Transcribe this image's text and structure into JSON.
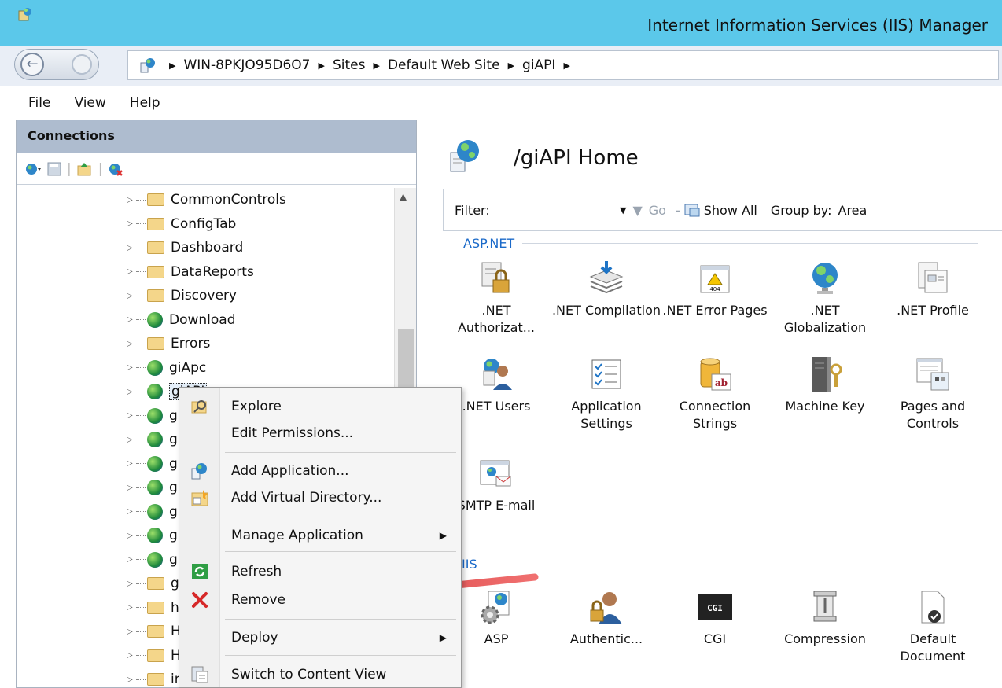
{
  "window": {
    "title": "Internet Information Services (IIS) Manager"
  },
  "breadcrumb": [
    "WIN-8PKJO95D6O7",
    "Sites",
    "Default Web Site",
    "giAPI"
  ],
  "menu": [
    "File",
    "View",
    "Help"
  ],
  "connections": {
    "header": "Connections",
    "tree": [
      {
        "label": "CommonControls",
        "type": "folder"
      },
      {
        "label": "ConfigTab",
        "type": "folder"
      },
      {
        "label": "Dashboard",
        "type": "folder"
      },
      {
        "label": "DataReports",
        "type": "folder"
      },
      {
        "label": "Discovery",
        "type": "folder"
      },
      {
        "label": "Download",
        "type": "app"
      },
      {
        "label": "Errors",
        "type": "folder"
      },
      {
        "label": "giApc",
        "type": "app"
      },
      {
        "label": "giAPI",
        "type": "app"
      },
      {
        "label": "gi",
        "type": "app"
      },
      {
        "label": "gi",
        "type": "app"
      },
      {
        "label": "gi",
        "type": "app"
      },
      {
        "label": "gi",
        "type": "app"
      },
      {
        "label": "gi",
        "type": "app"
      },
      {
        "label": "gi",
        "type": "app"
      },
      {
        "label": "gi",
        "type": "app"
      },
      {
        "label": "gi",
        "type": "folder"
      },
      {
        "label": "he",
        "type": "folder"
      },
      {
        "label": "H",
        "type": "folder"
      },
      {
        "label": "H",
        "type": "folder"
      },
      {
        "label": "im",
        "type": "folder"
      }
    ]
  },
  "main": {
    "title": "/giAPI Home",
    "filter": {
      "label": "Filter:",
      "go": "Go",
      "show_all": "Show All",
      "group_by": "Group by:",
      "group_value": "Area"
    },
    "groups": [
      {
        "name": "ASP.NET",
        "features": [
          {
            "label": ".NET Authorizat...",
            "icon": "lock-doc-icon"
          },
          {
            "label": ".NET Compilation",
            "icon": "layers-icon"
          },
          {
            "label": ".NET Error Pages",
            "icon": "error-page-icon"
          },
          {
            "label": ".NET Globalization",
            "icon": "globe-icon"
          },
          {
            "label": ".NET Profile",
            "icon": "profile-icon"
          },
          {
            "label": ".NET Users",
            "icon": "users-icon"
          },
          {
            "label": "Application Settings",
            "icon": "checklist-icon"
          },
          {
            "label": "Connection Strings",
            "icon": "database-icon"
          },
          {
            "label": "Machine Key",
            "icon": "server-key-icon"
          },
          {
            "label": "Pages and Controls",
            "icon": "pages-icon"
          },
          {
            "label": "SMTP E-mail",
            "icon": "email-icon"
          }
        ]
      },
      {
        "name": "IIS",
        "features": [
          {
            "label": "ASP",
            "icon": "asp-icon"
          },
          {
            "label": "Authentic...",
            "icon": "auth-icon"
          },
          {
            "label": "CGI",
            "icon": "cgi-icon"
          },
          {
            "label": "Compression",
            "icon": "compression-icon"
          },
          {
            "label": "Default Document",
            "icon": "default-doc-icon"
          }
        ]
      }
    ]
  },
  "context_menu": {
    "items": [
      {
        "label": "Explore",
        "icon": "explore-icon"
      },
      {
        "label": "Edit Permissions...",
        "icon": ""
      },
      {
        "label": "Add Application...",
        "icon": "add-app-icon"
      },
      {
        "label": "Add Virtual Directory...",
        "icon": "add-vdir-icon"
      },
      {
        "label": "Manage Application",
        "icon": "",
        "submenu": true
      },
      {
        "label": "Refresh",
        "icon": "refresh-icon"
      },
      {
        "label": "Remove",
        "icon": "remove-icon"
      },
      {
        "label": "Deploy",
        "icon": "",
        "submenu": true
      },
      {
        "label": "Switch to Content View",
        "icon": "content-view-icon"
      }
    ]
  },
  "colors": {
    "titlebar": "#5bc8ea",
    "group_header": "#1b6ac9",
    "arrow": "#e04848"
  }
}
